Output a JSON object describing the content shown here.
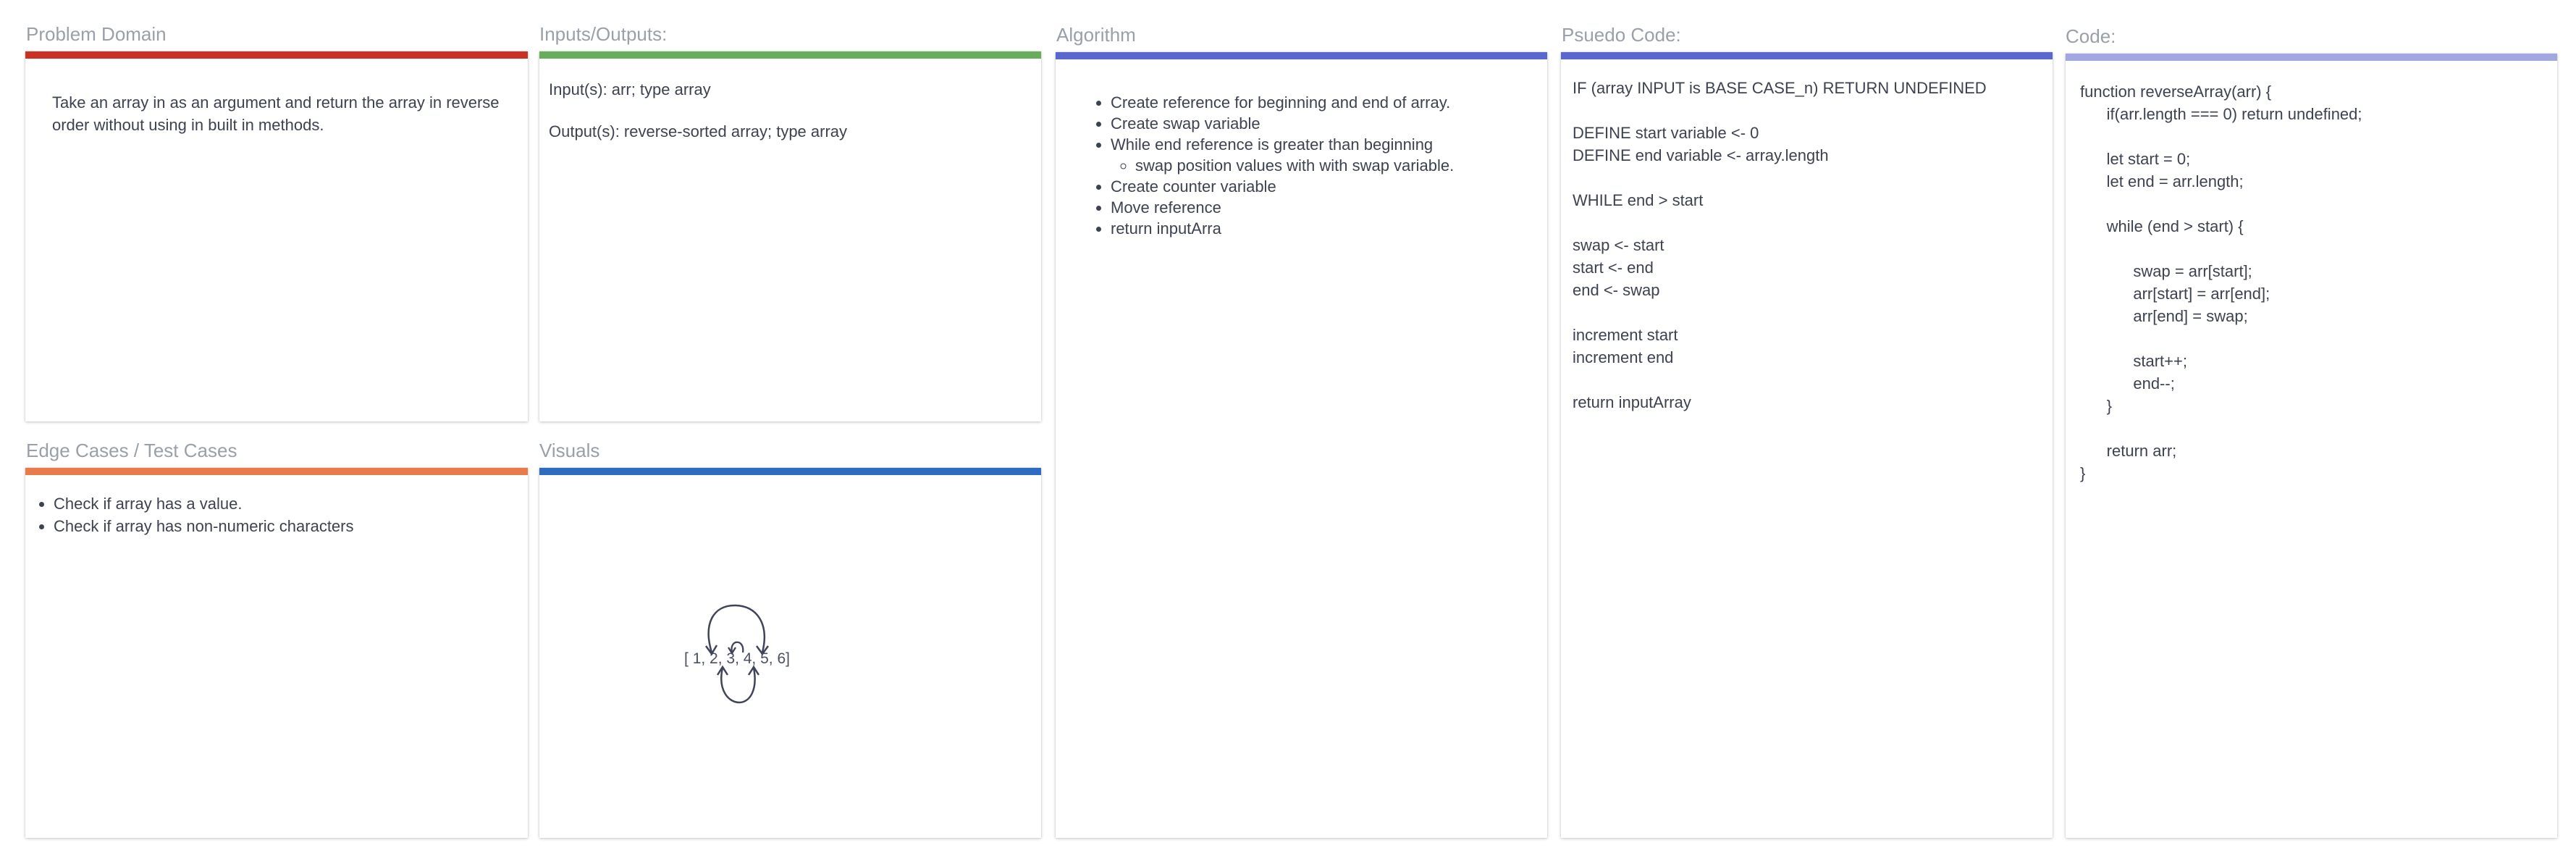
{
  "cards": {
    "problem_domain": {
      "title": "Problem Domain",
      "accent": "#cc2f24",
      "text": "Take an array in as an argument and return the array in reverse order without using in built in methods."
    },
    "inputs_outputs": {
      "title": "Inputs/Outputs:",
      "accent": "#67ad5b",
      "input": "Input(s): arr; type array",
      "output": "Output(s): reverse-sorted array; type array"
    },
    "algorithm": {
      "title": "Algorithm",
      "accent": "#5a67cf",
      "items": [
        "Create reference for beginning and end of array.",
        "Create swap variable",
        "While end reference is greater than beginning",
        "Create counter variable",
        "Move reference",
        "return inputArra"
      ],
      "sub_item": "swap position values with with swap variable."
    },
    "pseudo_code": {
      "title": "Psuedo Code:",
      "accent": "#5a67cf",
      "lines": [
        "IF (array INPUT is BASE CASE_n) RETURN UNDEFINED",
        "",
        "DEFINE start variable <- 0",
        "DEFINE end variable <- array.length",
        "",
        "WHILE end > start",
        "",
        "swap <- start",
        "start <- end",
        "end <- swap",
        "",
        "increment start",
        "increment end",
        "",
        "return inputArray"
      ]
    },
    "code": {
      "title": "Code:",
      "accent": "#a3a7e0",
      "lines": [
        "function reverseArray(arr) {",
        "      if(arr.length === 0) return undefined;",
        "",
        "      let start = 0;",
        "      let end = arr.length;",
        "",
        "      while (end > start) {",
        "",
        "            swap = arr[start];",
        "            arr[start] = arr[end];",
        "            arr[end] = swap;",
        "",
        "            start++;",
        "            end--;",
        "      }",
        "",
        "      return arr;",
        "}"
      ]
    },
    "edge_cases": {
      "title": "Edge Cases / Test Cases",
      "accent": "#e97b4b",
      "items": [
        "Check if array has a value.",
        "Check if array has non-numeric characters"
      ]
    },
    "visuals": {
      "title": "Visuals",
      "accent": "#2e6cc4",
      "array_text": "[ 1, 2, 3, 4, 5, 6]"
    }
  }
}
